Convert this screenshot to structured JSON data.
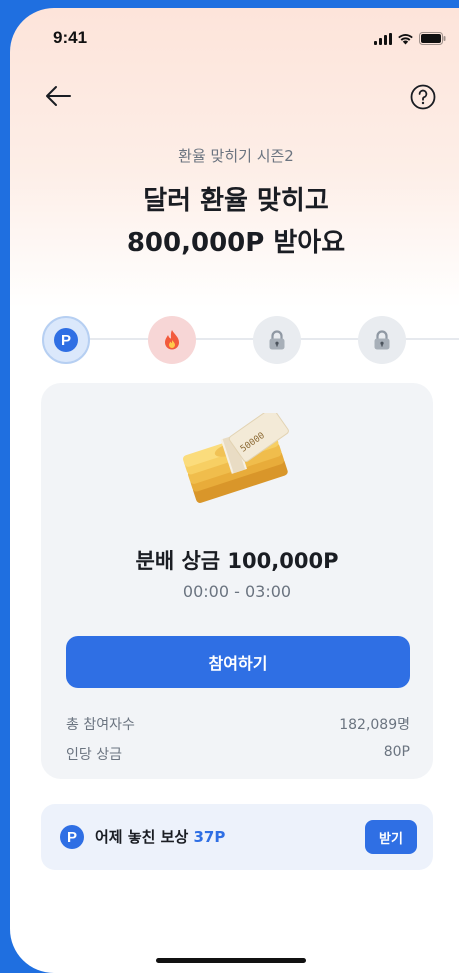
{
  "status_bar": {
    "time": "9:41",
    "icons": [
      "cellular-signal-icon",
      "wifi-icon",
      "battery-icon"
    ]
  },
  "nav": {
    "back_icon": "back-arrow-icon",
    "help_icon": "help-icon"
  },
  "header": {
    "subtitle": "환율 맞히기 시즌2",
    "title_line1": "달러 환율 맞히고",
    "title_line2": "800,000P 받아요"
  },
  "steps": [
    {
      "icon": "point-icon",
      "label": "P",
      "state": "active"
    },
    {
      "icon": "fire-icon",
      "state": "current"
    },
    {
      "icon": "lock-icon",
      "state": "locked"
    },
    {
      "icon": "lock-icon",
      "state": "locked"
    }
  ],
  "card": {
    "illustration": "money-stack-icon",
    "prize_title": "분배 상금 100,000P",
    "time_range": "00:00 - 03:00",
    "join_label": "참여하기",
    "stats": [
      {
        "label": "총 참여자수",
        "value": "182,089명"
      },
      {
        "label": "인당 상금",
        "value": "80P"
      }
    ]
  },
  "missed_reward": {
    "badge": "P",
    "text": "어제 놓친 보상",
    "amount": "37P",
    "claim_label": "받기"
  },
  "colors": {
    "accent": "#2f6fe4",
    "header_gradient_top": "#fde4da",
    "card_bg": "#f2f4f7",
    "fire_bg": "#f7d6d6",
    "locked_bg": "#e9ecf0"
  }
}
